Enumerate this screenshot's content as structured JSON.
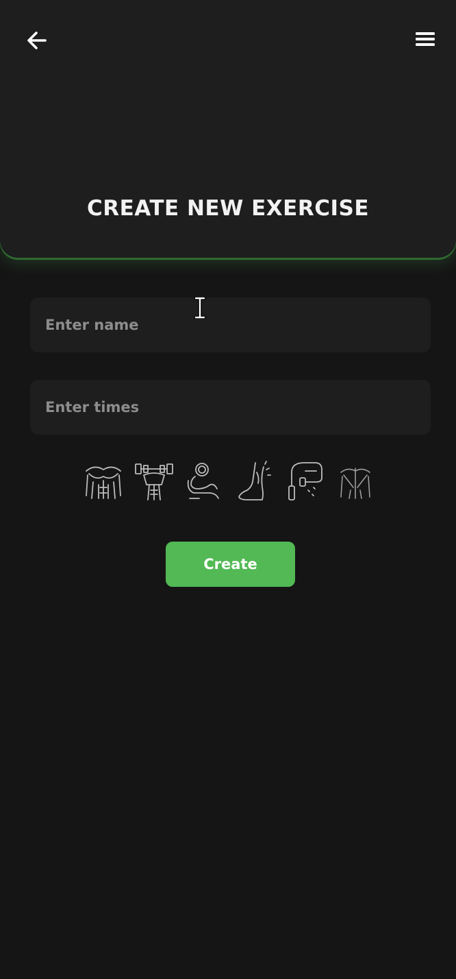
{
  "header": {
    "title": "CREATE NEW EXERCISE",
    "back_icon": "arrow-left-icon",
    "menu_icon": "hamburger-menu-icon"
  },
  "form": {
    "name_placeholder": "Enter name",
    "name_value": "",
    "times_placeholder": "Enter times",
    "times_value": ""
  },
  "muscle_icons": [
    "chest-muscle-icon",
    "shoulder-dumbbell-icon",
    "biceps-arm-icon",
    "leg-foot-icon",
    "jump-rope-icon",
    "back-muscle-icon"
  ],
  "actions": {
    "create_label": "Create"
  },
  "colors": {
    "background": "#151515",
    "header": "#1e1e1e",
    "accent": "#52b954",
    "input_bg": "#1e1e1e",
    "placeholder": "#8d8d8d"
  }
}
